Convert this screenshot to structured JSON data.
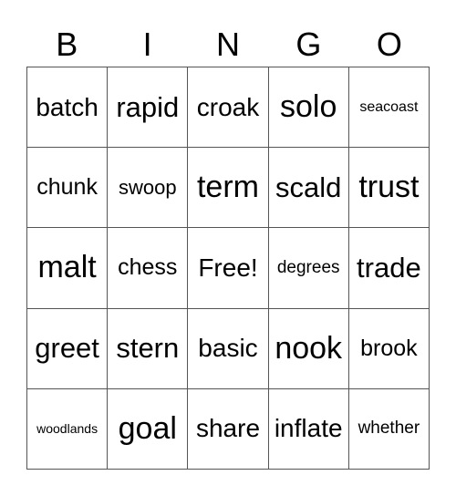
{
  "header": {
    "letters": [
      "B",
      "I",
      "N",
      "G",
      "O"
    ]
  },
  "board": {
    "rows": [
      [
        {
          "text": "batch",
          "size": "s-m"
        },
        {
          "text": "rapid",
          "size": "s-l"
        },
        {
          "text": "croak",
          "size": "s-m"
        },
        {
          "text": "solo",
          "size": "s-xl"
        },
        {
          "text": "seacoast",
          "size": "s-xs"
        }
      ],
      [
        {
          "text": "chunk",
          "size": "s-ms"
        },
        {
          "text": "swoop",
          "size": "s-sm"
        },
        {
          "text": "term",
          "size": "s-xl"
        },
        {
          "text": "scald",
          "size": "s-l"
        },
        {
          "text": "trust",
          "size": "s-xl"
        }
      ],
      [
        {
          "text": "malt",
          "size": "s-xl"
        },
        {
          "text": "chess",
          "size": "s-ms"
        },
        {
          "text": "Free!",
          "size": "s-m"
        },
        {
          "text": "degrees",
          "size": "s-s"
        },
        {
          "text": "trade",
          "size": "s-l"
        }
      ],
      [
        {
          "text": "greet",
          "size": "s-l"
        },
        {
          "text": "stern",
          "size": "s-l"
        },
        {
          "text": "basic",
          "size": "s-m"
        },
        {
          "text": "nook",
          "size": "s-xl"
        },
        {
          "text": "brook",
          "size": "s-ms"
        }
      ],
      [
        {
          "text": "woodlands",
          "size": "s-xxs"
        },
        {
          "text": "goal",
          "size": "s-xl"
        },
        {
          "text": "share",
          "size": "s-m"
        },
        {
          "text": "inflate",
          "size": "s-m"
        },
        {
          "text": "whether",
          "size": "s-s"
        }
      ]
    ]
  }
}
